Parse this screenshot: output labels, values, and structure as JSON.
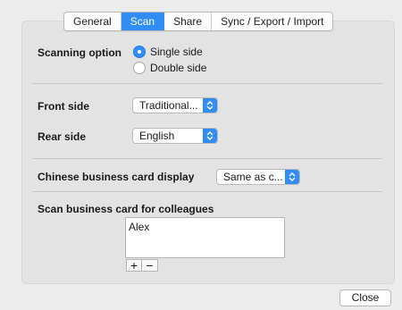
{
  "tabs": [
    {
      "label": "General",
      "active": false
    },
    {
      "label": "Scan",
      "active": true
    },
    {
      "label": "Share",
      "active": false
    },
    {
      "label": "Sync / Export / Import",
      "active": false
    }
  ],
  "scanning": {
    "label": "Scanning option",
    "options": [
      {
        "label": "Single side",
        "selected": true
      },
      {
        "label": "Double side",
        "selected": false
      }
    ]
  },
  "front_side": {
    "label": "Front side",
    "value": "Traditional..."
  },
  "rear_side": {
    "label": "Rear side",
    "value": "English"
  },
  "chinese_display": {
    "label": "Chinese business card display",
    "value": "Same as c..."
  },
  "colleagues": {
    "label": "Scan business card for colleagues",
    "items": [
      "Alex"
    ],
    "add_label": "+",
    "remove_label": "−"
  },
  "close_label": "Close",
  "colors": {
    "accent": "#2f8df4",
    "panel": "#e3e3e3",
    "window": "#ececec"
  }
}
